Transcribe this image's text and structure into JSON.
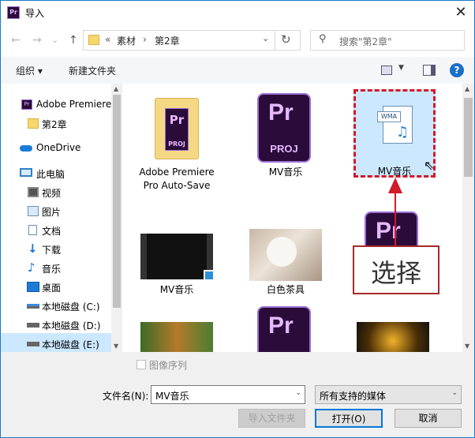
{
  "title": {
    "app_icon": "Pr",
    "text": "导入"
  },
  "nav": {
    "back": "←",
    "forward": "→",
    "dropdown": "⌄",
    "up": "↑"
  },
  "address": {
    "overflow": "«",
    "crumbs": [
      "素材",
      "第2章"
    ],
    "separator": "›"
  },
  "search": {
    "placeholder": "搜索\"第2章\""
  },
  "toolbar": {
    "organize": "组织 ▾",
    "new_folder": "新建文件夹"
  },
  "sidebar": {
    "items": [
      {
        "label": "Adobe Premiere"
      },
      {
        "label": "第2章"
      },
      {
        "label": "OneDrive"
      },
      {
        "label": "此电脑"
      },
      {
        "label": "视频"
      },
      {
        "label": "图片"
      },
      {
        "label": "文档"
      },
      {
        "label": "下载"
      },
      {
        "label": "音乐"
      },
      {
        "label": "桌面"
      },
      {
        "label": "本地磁盘 (C:)"
      },
      {
        "label": "本地磁盘 (D:)"
      },
      {
        "label": "本地磁盘 (E:)"
      }
    ]
  },
  "files": [
    {
      "label": "Adobe Premiere Pro Auto-Save",
      "icon": "pr-folder-icon"
    },
    {
      "label": "MV音乐",
      "icon": "pr-proj-icon",
      "badge": "PROJ"
    },
    {
      "label": "MV音乐",
      "icon": "wma-file-icon",
      "badge": "WMA"
    },
    {
      "label": "MV音乐",
      "icon": "video-thumbnail"
    },
    {
      "label": "白色茶具",
      "icon": "image-thumbnail"
    },
    {
      "label": "",
      "icon": "pr-icon"
    }
  ],
  "annotation": {
    "callout": "选择",
    "color": "#d11a2a"
  },
  "bottom": {
    "sequence_label": "图像序列",
    "filename_label": "文件名(N):",
    "filename_value": "MV音乐",
    "filetype_value": "所有支持的媒体",
    "import_folder": "导入文件夹",
    "open": "打开(O)",
    "cancel": "取消"
  }
}
